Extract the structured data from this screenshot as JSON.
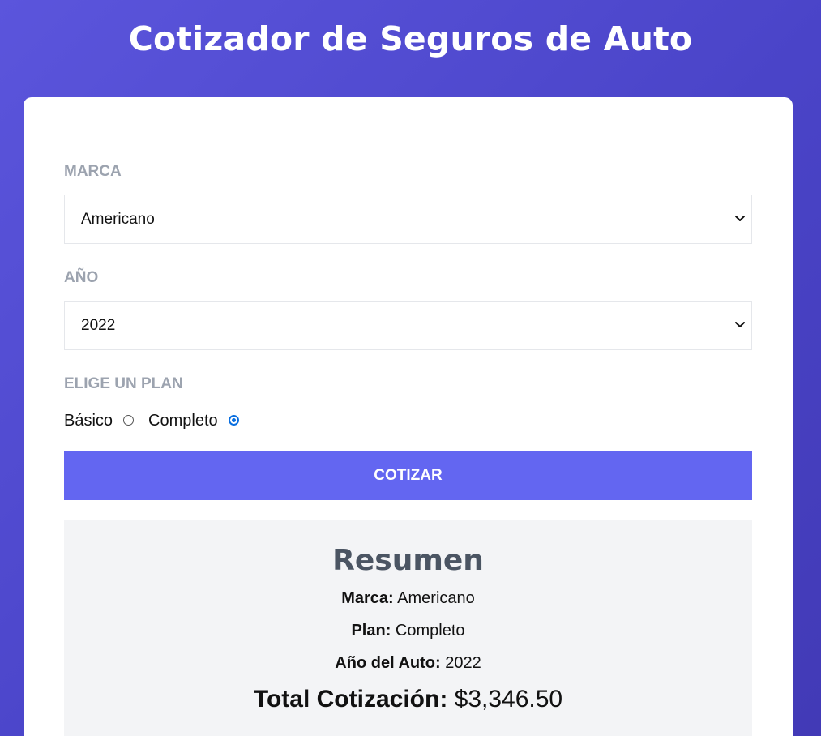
{
  "header": {
    "title": "Cotizador de Seguros de Auto"
  },
  "form": {
    "marca": {
      "label": "Marca",
      "selected": "Americano"
    },
    "anio": {
      "label": "Año",
      "selected": "2022"
    },
    "plan": {
      "label": "Elige un Plan",
      "options": [
        {
          "label": "Básico",
          "checked": false
        },
        {
          "label": "Completo",
          "checked": true
        }
      ]
    },
    "submit_label": "Cotizar"
  },
  "summary": {
    "title": "Resumen",
    "marca_key": "Marca:",
    "marca_value": "Americano",
    "plan_key": "Plan:",
    "plan_value": "Completo",
    "anio_key": "Año del Auto:",
    "anio_value": "2022",
    "total_key": "Total Cotización:",
    "total_value": "$3,346.50"
  },
  "icons": {
    "select_chevron": "chevron-down-icon"
  },
  "colors": {
    "background_gradient_start": "#5b55dc",
    "background_gradient_end": "#423ab6",
    "button": "#6366f1",
    "label": "#9ca3af",
    "summary_background": "#f3f4f6",
    "summary_title": "#4b5563",
    "radio_checked": "#0a6fe0"
  }
}
